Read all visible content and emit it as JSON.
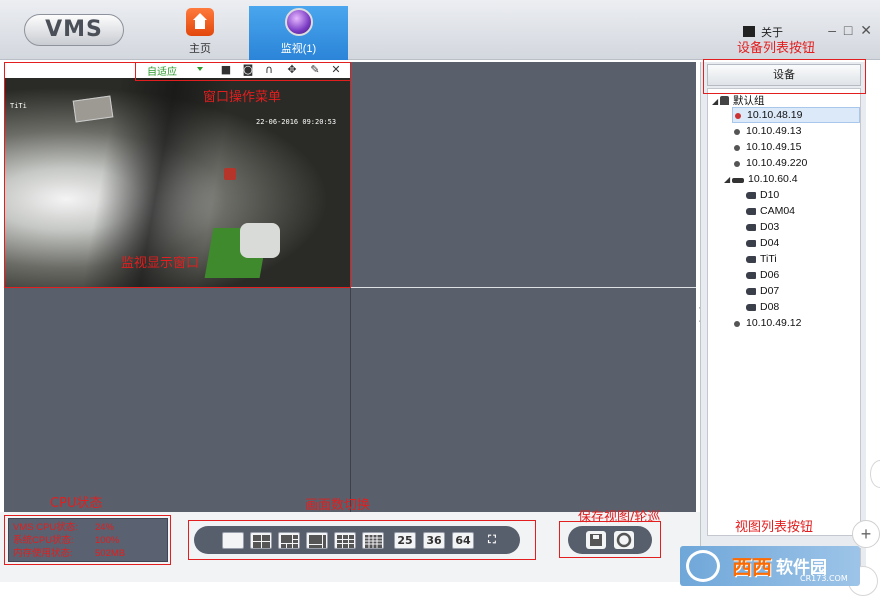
{
  "app": {
    "logo": "VMS",
    "tabs": [
      {
        "label": "主页"
      },
      {
        "label": "监视(1)"
      }
    ],
    "about_label": "关于",
    "window_controls": [
      "–",
      "□",
      "✕"
    ]
  },
  "video_pane": {
    "mode_label": "自适应",
    "toolbar_icons": [
      "record-icon",
      "snapshot-icon",
      "audio-icon",
      "ptz-icon",
      "settings-icon",
      "close-icon"
    ],
    "osd_left": "TiTi",
    "osd_time": "22-06-2016 09:20:53"
  },
  "device_panel": {
    "title": "设备",
    "tree": [
      {
        "label": "默认组",
        "kind": "group",
        "level": 0
      },
      {
        "label": "10.10.48.19",
        "kind": "device",
        "level": 1,
        "selected": true
      },
      {
        "label": "10.10.49.13",
        "kind": "device",
        "level": 1
      },
      {
        "label": "10.10.49.15",
        "kind": "device",
        "level": 1
      },
      {
        "label": "10.10.49.220",
        "kind": "device",
        "level": 1
      },
      {
        "label": "10.10.60.4",
        "kind": "nvr",
        "level": 1
      },
      {
        "label": "D10",
        "kind": "camera",
        "level": 2
      },
      {
        "label": "CAM04",
        "kind": "camera",
        "level": 2
      },
      {
        "label": "D03",
        "kind": "camera",
        "level": 2
      },
      {
        "label": "D04",
        "kind": "camera",
        "level": 2
      },
      {
        "label": "TiTi",
        "kind": "camera",
        "level": 2
      },
      {
        "label": "D06",
        "kind": "camera",
        "level": 2
      },
      {
        "label": "D07",
        "kind": "camera",
        "level": 2
      },
      {
        "label": "D08",
        "kind": "camera",
        "level": 2
      },
      {
        "label": "10.10.49.12",
        "kind": "device",
        "level": 1
      }
    ],
    "view_list_label": "视图"
  },
  "cpu_status": [
    {
      "label": "VMS CPU状态:",
      "value": "24%"
    },
    {
      "label": "系统CPU状态:",
      "value": "100%"
    },
    {
      "label": "内存使用状态:",
      "value": "502MB"
    }
  ],
  "layout_buttons": [
    "",
    "",
    "",
    "",
    "",
    "",
    "25",
    "36",
    "64",
    ""
  ],
  "annotations": {
    "window_menu": "窗口操作菜单",
    "display_window": "监视显示窗口",
    "device_list_button": "设备列表按钮",
    "view_list_button": "视图列表按钮",
    "cpu_status": "CPU状态",
    "layout_switch": "画面数切换",
    "save_view": "保存视图/轮巡"
  },
  "watermark": {
    "big": "西西",
    "brand": "软件园",
    "url": "CR173.COM"
  },
  "colors": {
    "annotation_red": "#e21e1e",
    "active_tab_blue": "#2b84d8",
    "pane_gray": "#59606c"
  }
}
